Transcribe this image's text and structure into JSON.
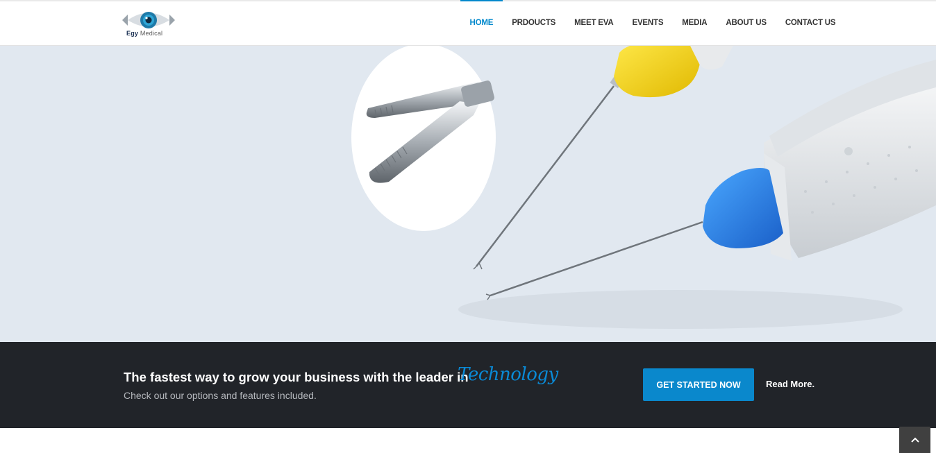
{
  "brand": {
    "logo_text_bold": "Egy",
    "logo_text_light": "Medical",
    "accent_color": "#0088cc"
  },
  "nav": {
    "items": [
      {
        "label": "HOME",
        "active": true
      },
      {
        "label": "PRDOUCTS",
        "active": false
      },
      {
        "label": "MEET EVA",
        "active": false
      },
      {
        "label": "EVENTS",
        "active": false
      },
      {
        "label": "MEDIA",
        "active": false
      },
      {
        "label": "ABOUT US",
        "active": false
      },
      {
        "label": "CONTACT US",
        "active": false
      }
    ]
  },
  "cta": {
    "title": "The fastest way to grow your business with the leader in",
    "accent_word": "Technology",
    "subtitle": "Check out our options and features included.",
    "button_label": "GET STARTED NOW",
    "read_more_label": "Read More."
  },
  "scroll_top": {
    "icon": "chevron-up-icon"
  }
}
